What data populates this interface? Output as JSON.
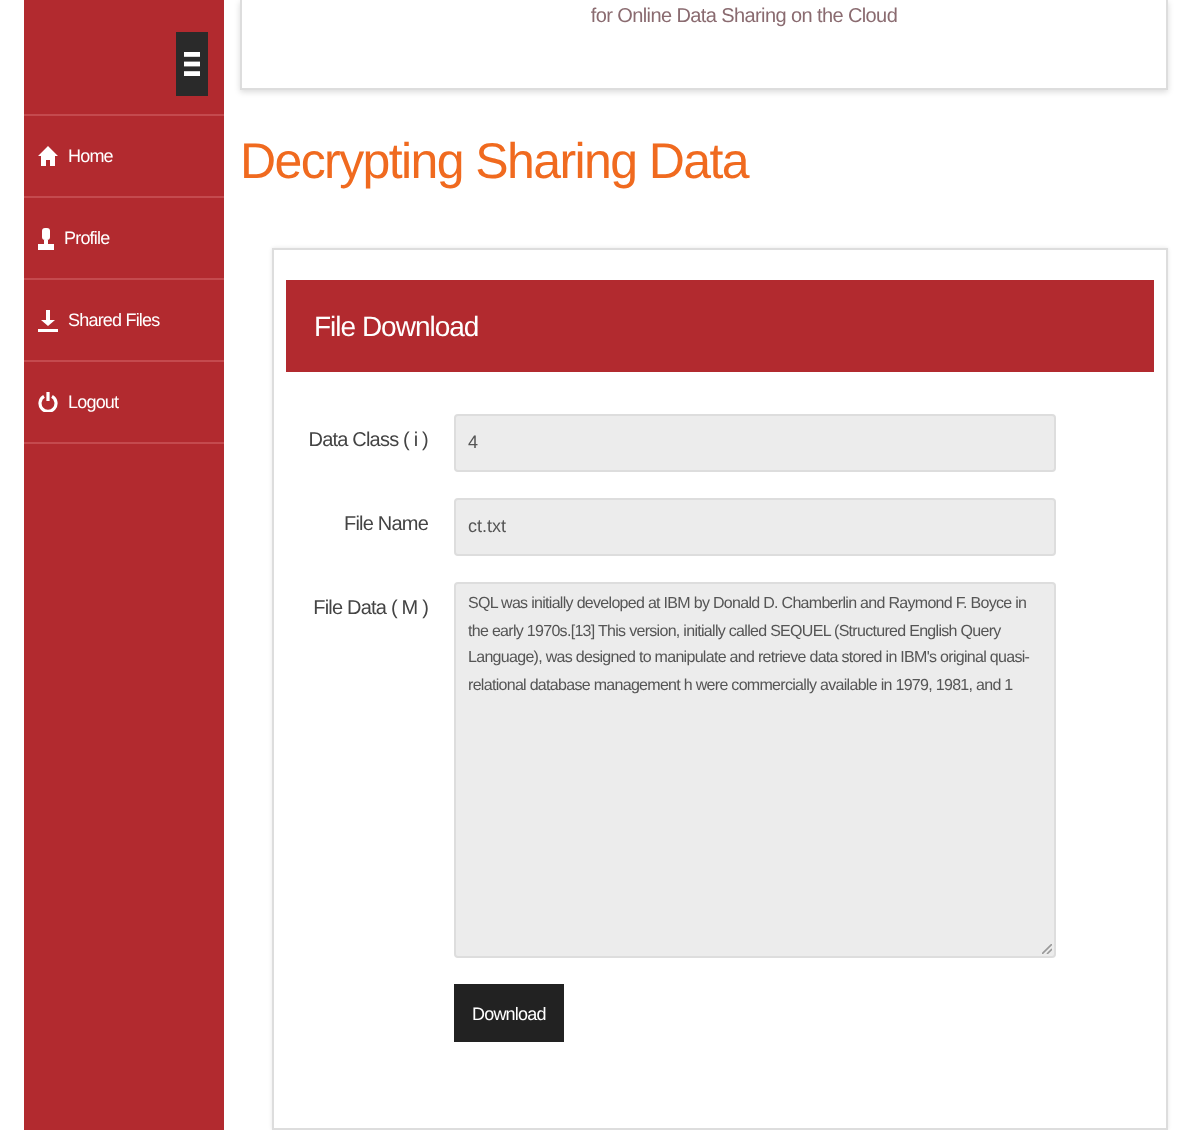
{
  "header": {
    "subtitle": "for Online Data Sharing on the Cloud"
  },
  "sidebar": {
    "items": [
      {
        "label": "Home"
      },
      {
        "label": "Profile"
      },
      {
        "label": "Shared Files"
      },
      {
        "label": "Logout"
      }
    ]
  },
  "page_title": "Decrypting Sharing Data",
  "panel": {
    "title": "File Download",
    "fields": [
      {
        "kind": "input",
        "label": "Data Class ( i )",
        "value": "4"
      },
      {
        "kind": "input",
        "label": "File Name",
        "value": "ct.txt"
      },
      {
        "kind": "textarea",
        "label": "File Data ( M )",
        "value": " SQL was initially developed at IBM by Donald D. Chamberlin and Raymond F. Boyce in the early 1970s.[13] This version, initially called SEQUEL (Structured English Query Language), was designed to manipulate and retrieve data stored in IBM's original quasi-relational database management h were commercially available in 1979, 1981, and 1"
      }
    ],
    "button": "Download"
  }
}
